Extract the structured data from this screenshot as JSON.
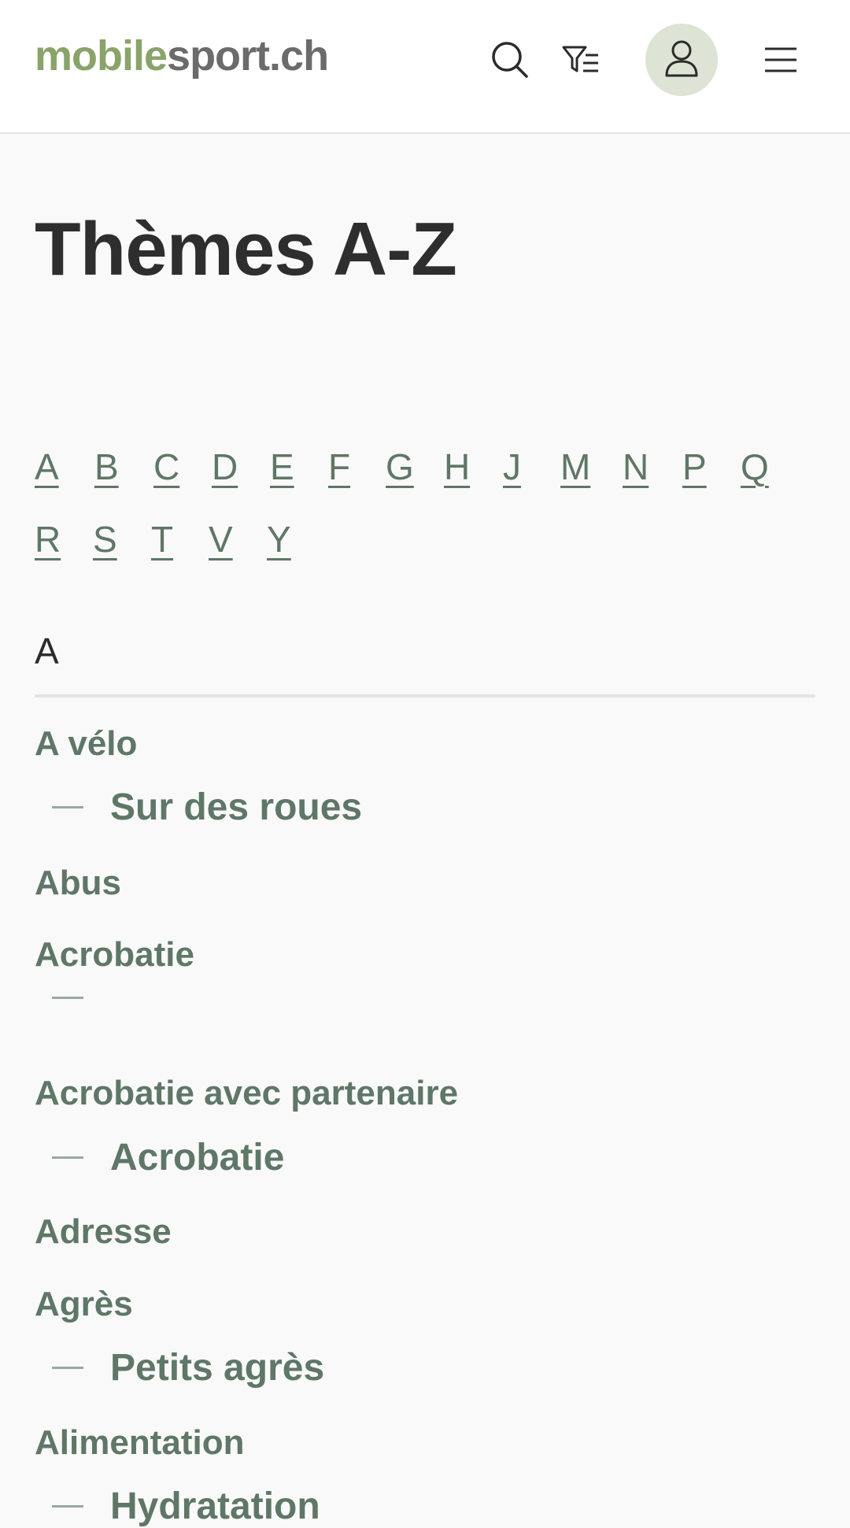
{
  "header": {
    "logo_part1": "mobile",
    "logo_part2": "sport.ch",
    "icons": [
      "search-icon",
      "filter-icon",
      "user-icon",
      "menu-icon"
    ]
  },
  "page": {
    "title": "Thèmes A-Z"
  },
  "letters": [
    "A",
    "B",
    "C",
    "D",
    "E",
    "F",
    "G",
    "H",
    "J",
    "M",
    "N",
    "P",
    "Q",
    "R",
    "S",
    "T",
    "V",
    "Y"
  ],
  "section": {
    "letter": "A",
    "entries": [
      {
        "label": "A vélo",
        "sub": "Sur des roues"
      },
      {
        "label": "Abus",
        "sub": null
      },
      {
        "label": "Acrobatie",
        "sub": ""
      },
      {
        "label": "Acrobatie avec partenaire",
        "sub": "Acrobatie"
      },
      {
        "label": "Adresse",
        "sub": null
      },
      {
        "label": "Agrès",
        "sub": "Petits agrès"
      },
      {
        "label": "Alimentation",
        "sub": "Hydratation"
      }
    ]
  },
  "colors": {
    "accent": "#5f7766",
    "logo_green": "#8aa36a",
    "logo_gray": "#6b6b6b",
    "avatar_bg": "#dde3d5"
  }
}
